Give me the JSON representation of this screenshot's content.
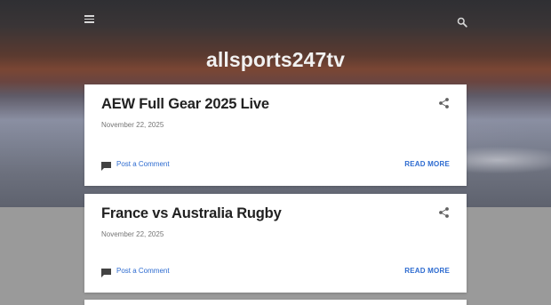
{
  "site": {
    "title": "allsports247tv"
  },
  "header": {
    "menu_icon": "hamburger-menu-icon",
    "search_icon": "search-icon"
  },
  "posts": [
    {
      "title": "AEW Full Gear 2025 Live",
      "date": "November 22, 2025",
      "comment_label": "Post a Comment",
      "read_more_label": "READ MORE"
    },
    {
      "title": "France vs Australia Rugby",
      "date": "November 22, 2025",
      "comment_label": "Post a Comment",
      "read_more_label": "READ MORE"
    }
  ],
  "colors": {
    "link": "#2d6bd0",
    "title": "#212121",
    "date": "#757575",
    "header_text": "#f1f1f1"
  }
}
